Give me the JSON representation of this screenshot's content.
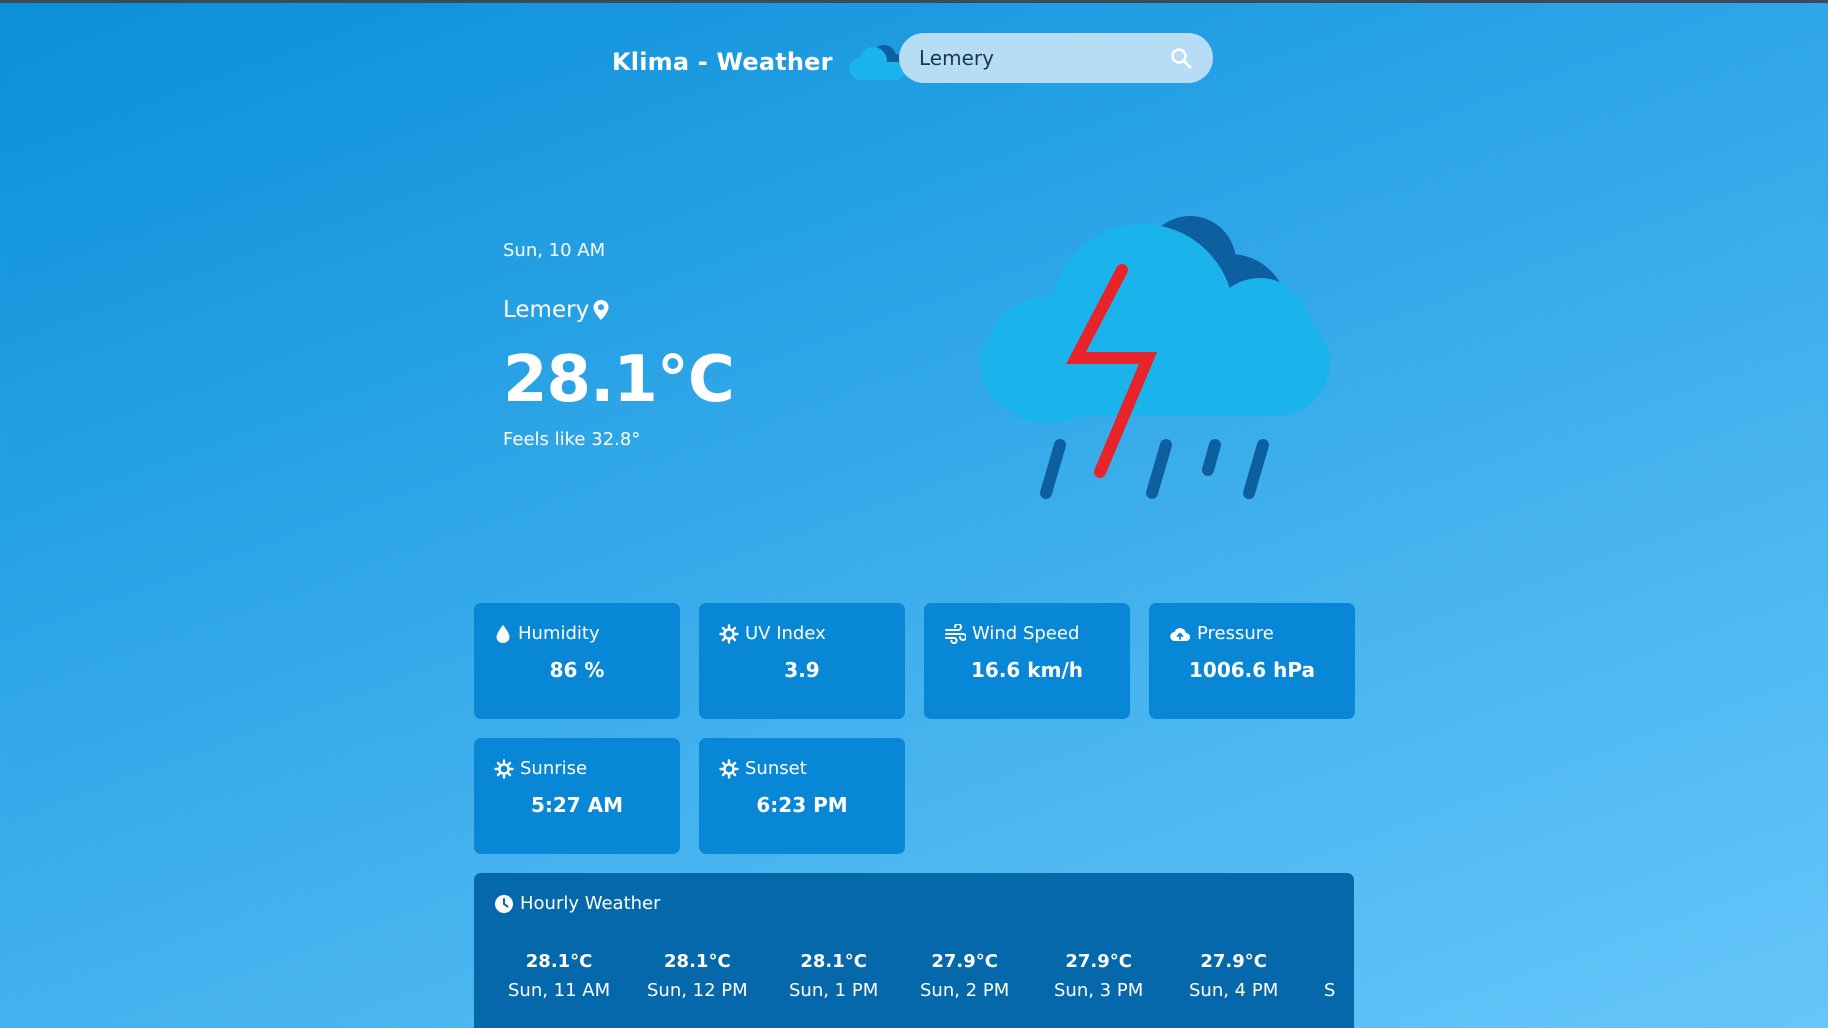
{
  "header": {
    "title": "Klima - Weather",
    "search_value": "Lemery",
    "search_placeholder": ""
  },
  "current": {
    "date": "Sun, 10 AM",
    "location": "Lemery",
    "temperature": "28.1°C",
    "feels_like": "Feels like 32.8°",
    "condition_icon": "thunderstorm-rain-icon"
  },
  "stats": [
    {
      "label": "Humidity",
      "value": "86 %",
      "icon": "droplet-icon"
    },
    {
      "label": "UV Index",
      "value": "3.9",
      "icon": "sun-icon"
    },
    {
      "label": "Wind Speed",
      "value": "16.6 km/h",
      "icon": "wind-icon"
    },
    {
      "label": "Pressure",
      "value": "1006.6 hPa",
      "icon": "cloud-upload-icon"
    },
    {
      "label": "Sunrise",
      "value": "5:27 AM",
      "icon": "sun-icon"
    },
    {
      "label": "Sunset",
      "value": "6:23 PM",
      "icon": "sun-icon"
    }
  ],
  "hourly": {
    "title": "Hourly Weather",
    "items": [
      {
        "temp": "28.1°C",
        "time": "Sun, 11 AM"
      },
      {
        "temp": "28.1°C",
        "time": "Sun, 12 PM"
      },
      {
        "temp": "28.1°C",
        "time": "Sun, 1 PM"
      },
      {
        "temp": "27.9°C",
        "time": "Sun, 2 PM"
      },
      {
        "temp": "27.9°C",
        "time": "Sun, 3 PM"
      },
      {
        "temp": "27.9°C",
        "time": "Sun, 4 PM"
      },
      {
        "temp": "",
        "time": "S"
      }
    ]
  },
  "colors": {
    "cloud_light": "#1ab3ec",
    "cloud_dark": "#0d5fa0",
    "lightning": "#e8232a",
    "card": "#0887d6",
    "hourly_panel": "#0568aa"
  }
}
